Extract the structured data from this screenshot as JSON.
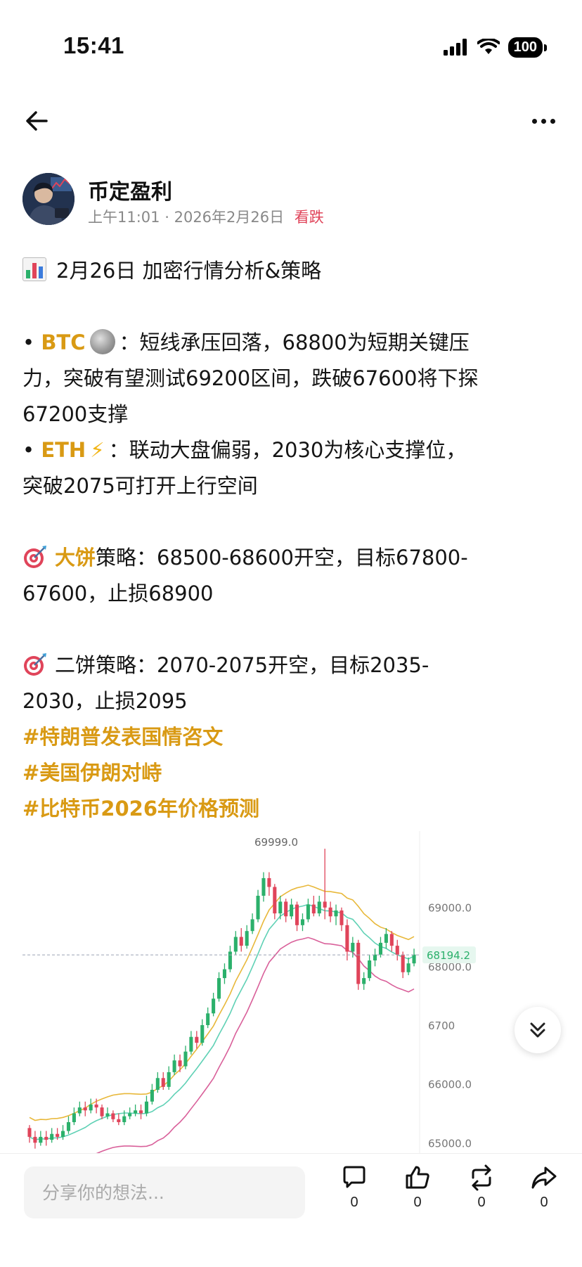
{
  "status_bar": {
    "time": "15:41",
    "battery": "100"
  },
  "post": {
    "author": "币定盈利",
    "time": "上午11:01",
    "separator": "·",
    "date": "2026年2月26日",
    "sentiment": "看跌",
    "heading": "2月26日 加密行情分析&策略",
    "btc": {
      "bullet": "•",
      "label": "BTC",
      "text_line1": "：短线承压回落，68800为短期关键压",
      "text_line2": "力，突破有望测试69200区间，跌破67600将下探",
      "text_line3": "67200支撑"
    },
    "eth": {
      "bullet": "•",
      "label": "ETH",
      "bolt": "⚡",
      "text_line1": "：联动大盘偏弱，2030为核心支撑位，",
      "text_line2": "突破2075可打开上行空间"
    },
    "strategy1": {
      "label": "大饼",
      "text_line1": "策略：68500-68600开空，目标67800-",
      "text_line2": "67600，止损68900"
    },
    "strategy2": {
      "text_line1": "二饼策略：2070-2075开空，目标2035-",
      "text_line2": "2030，止损2095"
    },
    "hashtags": [
      "#特朗普发表国情咨文",
      "#美国伊朗对峙",
      "#比特币2026年价格预测"
    ]
  },
  "chart_data": {
    "type": "candlestick",
    "title": "",
    "y_ticks": [
      "69000.0",
      "68000.0",
      "6700",
      "66000.0",
      "65000.0"
    ],
    "y_range": [
      64800,
      70300
    ],
    "high_label": "69999.0",
    "current_price": "68194.2",
    "candles": [
      [
        65250,
        65100,
        65300,
        65000
      ],
      [
        65100,
        65000,
        65200,
        64900
      ],
      [
        65000,
        65100,
        65200,
        64950
      ],
      [
        65100,
        65050,
        65200,
        64950
      ],
      [
        65050,
        65150,
        65250,
        65000
      ],
      [
        65150,
        65100,
        65250,
        65050
      ],
      [
        65100,
        65200,
        65300,
        65050
      ],
      [
        65200,
        65350,
        65450,
        65150
      ],
      [
        65350,
        65500,
        65600,
        65300
      ],
      [
        65500,
        65600,
        65700,
        65450
      ],
      [
        65600,
        65550,
        65700,
        65450
      ],
      [
        65550,
        65650,
        65750,
        65500
      ],
      [
        65650,
        65600,
        65750,
        65500
      ],
      [
        65600,
        65450,
        65650,
        65400
      ],
      [
        65450,
        65500,
        65600,
        65400
      ],
      [
        65500,
        65400,
        65550,
        65350
      ],
      [
        65400,
        65350,
        65500,
        65300
      ],
      [
        65350,
        65450,
        65550,
        65300
      ],
      [
        65450,
        65500,
        65600,
        65400
      ],
      [
        65500,
        65550,
        65650,
        65450
      ],
      [
        65550,
        65500,
        65650,
        65400
      ],
      [
        65500,
        65700,
        65800,
        65450
      ],
      [
        65700,
        65900,
        66000,
        65650
      ],
      [
        65900,
        66100,
        66200,
        65850
      ],
      [
        66100,
        65950,
        66200,
        65900
      ],
      [
        65950,
        66200,
        66300,
        65900
      ],
      [
        66200,
        66400,
        66500,
        66150
      ],
      [
        66400,
        66300,
        66500,
        66200
      ],
      [
        66300,
        66550,
        66650,
        66250
      ],
      [
        66550,
        66800,
        66900,
        66500
      ],
      [
        66800,
        66700,
        66900,
        66600
      ],
      [
        66700,
        67000,
        67100,
        66650
      ],
      [
        67000,
        67200,
        67300,
        66950
      ],
      [
        67200,
        67450,
        67550,
        67150
      ],
      [
        67450,
        67800,
        67900,
        67400
      ],
      [
        67800,
        67950,
        68050,
        67700
      ],
      [
        67950,
        68250,
        68350,
        67900
      ],
      [
        68250,
        68500,
        68600,
        68200
      ],
      [
        68500,
        68350,
        68650,
        68250
      ],
      [
        68350,
        68600,
        68700,
        68300
      ],
      [
        68600,
        68800,
        68900,
        68550
      ],
      [
        68800,
        69200,
        69300,
        68750
      ],
      [
        69200,
        69500,
        69600,
        69100
      ],
      [
        69500,
        69350,
        69600,
        69200
      ],
      [
        69350,
        68900,
        69400,
        68800
      ],
      [
        68900,
        69100,
        69200,
        68800
      ],
      [
        69100,
        68850,
        69150,
        68750
      ],
      [
        68850,
        69050,
        69150,
        68800
      ],
      [
        69050,
        68700,
        69100,
        68600
      ],
      [
        68700,
        68800,
        68900,
        68600
      ],
      [
        68800,
        69050,
        69150,
        68750
      ],
      [
        69050,
        68900,
        69200,
        68850
      ],
      [
        68900,
        69100,
        69200,
        68850
      ],
      [
        69100,
        69000,
        69999,
        68800
      ],
      [
        69000,
        68850,
        69100,
        68750
      ],
      [
        68850,
        68950,
        69050,
        68700
      ],
      [
        68950,
        68700,
        69000,
        68600
      ],
      [
        68700,
        68250,
        68800,
        68100
      ],
      [
        68250,
        68400,
        68500,
        68150
      ],
      [
        68400,
        67700,
        68450,
        67600
      ],
      [
        67700,
        67800,
        67900,
        67600
      ],
      [
        67800,
        68100,
        68200,
        67750
      ],
      [
        68100,
        68200,
        68300,
        68000
      ],
      [
        68200,
        68400,
        68500,
        68150
      ],
      [
        68400,
        68550,
        68650,
        68300
      ],
      [
        68550,
        68350,
        68600,
        68250
      ],
      [
        68350,
        68200,
        68450,
        68100
      ],
      [
        68200,
        67900,
        68250,
        67800
      ],
      [
        67900,
        68050,
        68150,
        67850
      ],
      [
        68050,
        68200,
        68300,
        68000
      ]
    ]
  },
  "comment_box": {
    "placeholder": "分享你的想法..."
  },
  "actions": [
    {
      "icon": "comment-icon",
      "count": "0"
    },
    {
      "icon": "like-icon",
      "count": "0"
    },
    {
      "icon": "repost-icon",
      "count": "0"
    },
    {
      "icon": "share-icon",
      "count": "0"
    }
  ],
  "colors": {
    "up": "#2bb06b",
    "down": "#e0445a",
    "accent": "#d99a14"
  }
}
